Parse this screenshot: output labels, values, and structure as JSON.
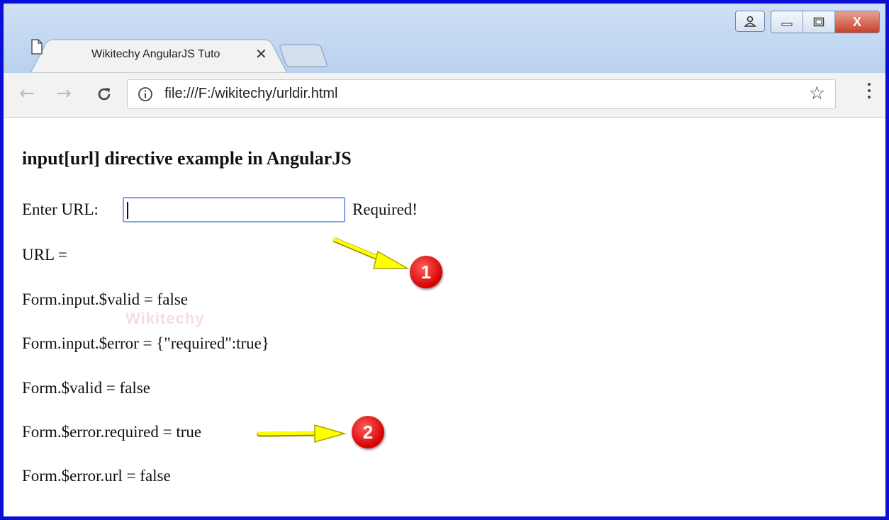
{
  "browser": {
    "tab_title": "Wikitechy AngularJS Tuto",
    "tab_close_glyph": "✕",
    "url": "file:///F:/wikitechy/urldir.html",
    "icons": [
      "page-icon",
      "back-arrow-icon",
      "forward-arrow-icon",
      "reload-icon",
      "info-icon",
      "star-icon",
      "kebab-menu-icon",
      "user-icon",
      "minimize-icon",
      "maximize-icon",
      "close-icon"
    ],
    "window_close_glyph": "X"
  },
  "page": {
    "heading": "input[url] directive example in AngularJS",
    "enter_url_label": "Enter URL:",
    "url_input_value": "",
    "required_text": "Required!",
    "url_line": "URL =",
    "input_valid_line": "Form.input.$valid = false",
    "input_error_line": "Form.input.$error = {\"required\":true}",
    "form_valid_line": "Form.$valid = false",
    "error_required_line": "Form.$error.required = true",
    "error_url_line": "Form.$error.url = false"
  },
  "annotations": {
    "badge1": "1",
    "badge2": "2",
    "arrow_color": "#ffff00",
    "badge_color": "#e00000"
  },
  "watermark": "Wikitechy",
  "colors": {
    "frame_border": "#0a0fd8",
    "titlebar": "#c4d8f1",
    "input_focus": "#7da2e8"
  }
}
